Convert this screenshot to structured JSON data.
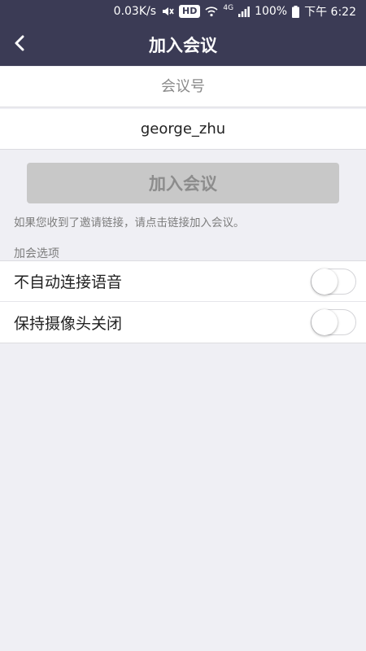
{
  "status_bar": {
    "speed": "0.03K/s",
    "hd": "HD",
    "network": "4G",
    "battery": "100%",
    "time": "下午 6:22"
  },
  "nav": {
    "back_icon": "chevron-left-icon",
    "title": "加入会议"
  },
  "form": {
    "meeting_id_placeholder": "会议号",
    "meeting_id_value": "",
    "name_value": "george_zhu",
    "join_button_label": "加入会议",
    "hint": "如果您收到了邀请链接，请点击链接加入会议。"
  },
  "options": {
    "section_label": "加会选项",
    "items": [
      {
        "label": "不自动连接语音",
        "enabled": false
      },
      {
        "label": "保持摄像头关闭",
        "enabled": false
      }
    ]
  },
  "colors": {
    "header_bg": "#3b3b55",
    "page_bg": "#efeff4",
    "disabled_button_bg": "#c8c8c8"
  }
}
